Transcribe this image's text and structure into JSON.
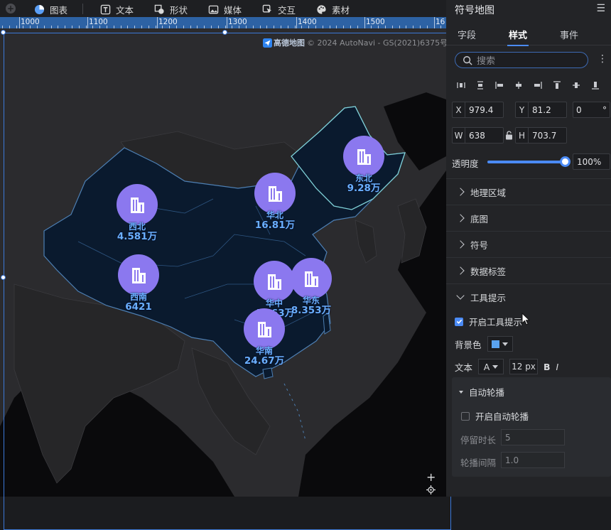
{
  "toolbar": {
    "items": [
      {
        "label": "图表",
        "icon": "chart-icon"
      },
      {
        "label": "文本",
        "icon": "text-icon"
      },
      {
        "label": "形状",
        "icon": "shape-icon"
      },
      {
        "label": "媒体",
        "icon": "media-icon"
      },
      {
        "label": "交互",
        "icon": "interaction-icon"
      },
      {
        "label": "素材",
        "icon": "palette-icon"
      }
    ]
  },
  "ruler": {
    "labels": [
      "1000",
      "1100",
      "1200",
      "1300",
      "1400",
      "1500",
      "16"
    ]
  },
  "map": {
    "attribution_logo": "高德地图",
    "attribution_text": "© 2024 AutoNavi - GS(2021)6375号",
    "markers": [
      {
        "name": "西北",
        "value": "4.581万"
      },
      {
        "name": "华北",
        "value": "16.81万"
      },
      {
        "name": "东北",
        "value": "9.28万"
      },
      {
        "name": "西南",
        "value": "6421"
      },
      {
        "name": "华中",
        "value": "4.463万"
      },
      {
        "name": "华东",
        "value": "8.353万"
      },
      {
        "name": "华南",
        "value": "24.67万"
      }
    ],
    "zoom_icon": "+",
    "locate_icon": "locate-icon"
  },
  "panel": {
    "title": "符号地图",
    "menu_icon": "menu-icon",
    "tabs": [
      "字段",
      "样式",
      "事件"
    ],
    "active_tab": "样式",
    "search_placeholder": "搜索",
    "fields": {
      "x_label": "X",
      "x_value": "979.4",
      "y_label": "Y",
      "y_value": "81.2",
      "rot_value": "0",
      "rot_unit": "°",
      "w_label": "W",
      "w_value": "638",
      "h_label": "H",
      "h_value": "703.7"
    },
    "opacity": {
      "label": "透明度",
      "value": "100%",
      "fraction": 1.0
    },
    "sections": [
      "地理区域",
      "底图",
      "符号",
      "数据标签",
      "工具提示"
    ],
    "tooltip": {
      "enable_label": "开启工具提示",
      "enabled": true,
      "bg_label": "背景色",
      "bg_color": "#5aa3f0",
      "text_label": "文本",
      "font_glyph": "A",
      "font_size": "12 px",
      "bold_glyph": "B",
      "italic_glyph": "I"
    },
    "autoplay": {
      "title": "自动轮播",
      "enable_label": "开启自动轮播",
      "enabled": false,
      "dwell_label": "停留时长",
      "dwell_value": "5",
      "interval_label": "轮播间隔",
      "interval_value": "1.0"
    }
  }
}
